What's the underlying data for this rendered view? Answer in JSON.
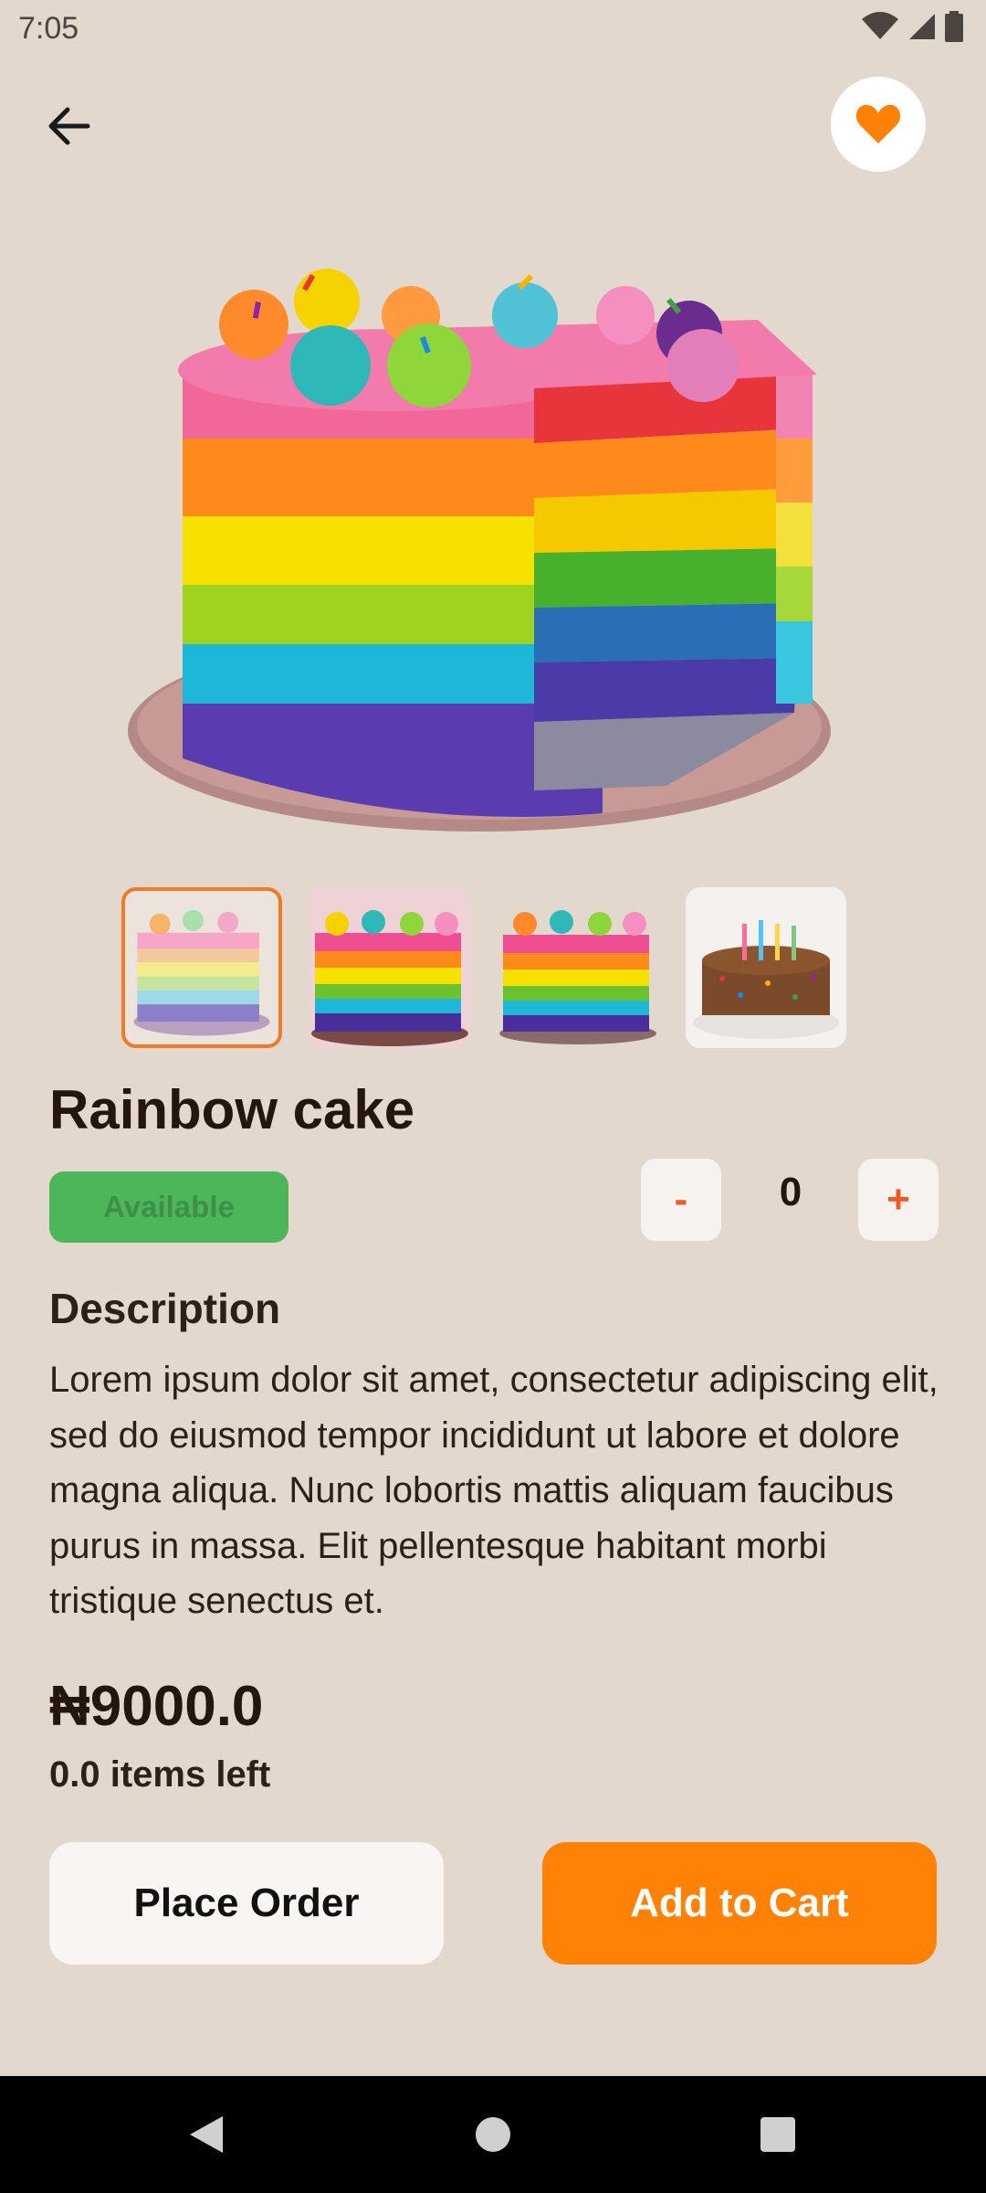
{
  "status_bar": {
    "time": "7:05",
    "icons": [
      "wifi-icon",
      "cellular-signal-icon",
      "battery-icon"
    ]
  },
  "header": {
    "back_icon": "arrow-left-icon",
    "favorite_icon": "heart-icon"
  },
  "product": {
    "title": "Rainbow cake",
    "availability": "Available",
    "quantity": "0",
    "minus_label": "-",
    "plus_label": "+",
    "description_heading": "Description",
    "description": "Lorem ipsum dolor sit amet, consectetur adipiscing elit, sed do eiusmod tempor incididunt ut labore et dolore magna aliqua. Nunc lobortis mattis aliquam faucibus purus in massa. Elit pellentesque habitant morbi tristique senectus et.",
    "price": "₦9000.0",
    "items_left": "0.0 items left",
    "thumbnails": [
      "rainbow-cake-1",
      "rainbow-cake-2",
      "rainbow-cake-3",
      "chocolate-sprinkle-cake"
    ]
  },
  "actions": {
    "place_order": "Place Order",
    "add_to_cart": "Add to Cart"
  },
  "nav": {
    "icons": [
      "nav-back-icon",
      "nav-home-icon",
      "nav-recents-icon"
    ]
  },
  "colors": {
    "background": "#e2d8ce",
    "accent": "#ff8207",
    "available": "#4db55a",
    "stepper_text": "#f05a22"
  }
}
